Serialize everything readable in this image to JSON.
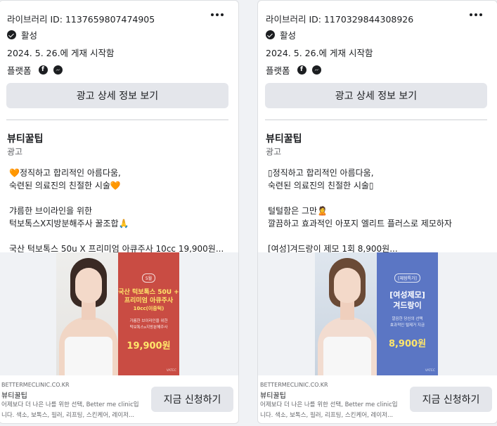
{
  "cards": [
    {
      "library_id": "라이브러리 ID: 1137659807474905",
      "status": "활성",
      "start_date": "2024. 5. 26.에 게재 시작함",
      "platforms_label": "플랫폼",
      "details_button": "광고 상세 정보 보기",
      "page_name": "뷰티꿀팁",
      "ad_label": "광고",
      "body_lines": [
        "🧡정직하고 합리적인 아름다움,",
        "숙련된 의료진의 친절한 시술🧡",
        "",
        "갸름한 브이라인을 위한",
        "턱보톡스X지방분해주사 꿀조합🙏",
        "",
        "국산 턱보톡스 50u X 프리미엄 아큐주사 10cc 19,900원..."
      ],
      "creative": {
        "tag": "5월",
        "line1": "국산 턱보톡스 50U +",
        "line2": "프리미엄 아큐주사",
        "line3": "10cc(이중턱)",
        "small1": "가름한 브이라인을 위한",
        "small2": "턱보톡스x지방분해주사",
        "price": "19,900원",
        "brand": "VATEC"
      },
      "domain": "BETTERMECLINIC.CO.KR",
      "footer_name": "뷰티꿀팁",
      "footer_desc_1": "어제보다 더 나은 나를 위한 선택, Better me clinic입",
      "footer_desc_2": "니다. 색소, 보톡스, 필러, 리프팅, 스킨케어, 레이저...",
      "cta": "지금 신청하기"
    },
    {
      "library_id": "라이브러리 ID: 1170329844308926",
      "status": "활성",
      "start_date": "2024. 5. 26.에 게재 시작함",
      "platforms_label": "플랫폼",
      "details_button": "광고 상세 정보 보기",
      "page_name": "뷰티꿀팁",
      "ad_label": "광고",
      "body_lines": [
        "▯정직하고 합리적인 아름다움,",
        "숙련된 의료진의 친절한 시술▯",
        "",
        "털털함은 그만🙎",
        "깔끔하고 효과적인 아포지 엘리트 플러스로 제모하자",
        "",
        "[여성]겨드랑이 제모 1회 8,900원..."
      ],
      "creative": {
        "tag": "[체험특가]",
        "line1": "[여성제모]",
        "line2": "겨드랑이",
        "line3": "",
        "small1": "깔끔한 당신의 선택",
        "small2": "효과적인 털제거 지금",
        "price": "8,900원",
        "brand": "VATEC"
      },
      "domain": "BETTERMECLINIC.CO.KR",
      "footer_name": "뷰티꿀팁",
      "footer_desc_1": "어제보다 더 나은 나를 위한 선택, Better me clinic입",
      "footer_desc_2": "니다. 색소, 보톡스, 필러, 리프팅, 스킨케어, 레이저...",
      "cta": "지금 신청하기"
    }
  ],
  "icons": {
    "more": "more-options-icon",
    "status": "check-circle-icon",
    "facebook": "facebook-icon",
    "messenger": "messenger-icon"
  }
}
